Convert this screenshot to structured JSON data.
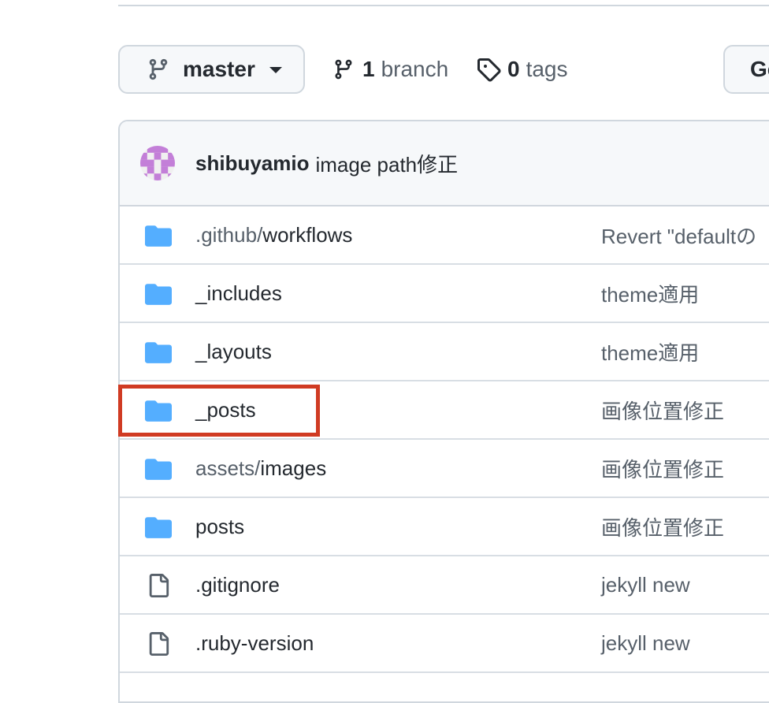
{
  "branch_selector": {
    "label": "master"
  },
  "branches": {
    "count": "1",
    "label": "branch"
  },
  "tags": {
    "count": "0",
    "label": "tags"
  },
  "goto_button": {
    "label": "Go to file"
  },
  "latest_commit": {
    "author": "shibuyamio",
    "message": "image path修正"
  },
  "files": [
    {
      "type": "dir",
      "prefix": ".github/",
      "name": "workflows",
      "commit": "Revert \"defaultの"
    },
    {
      "type": "dir",
      "prefix": "",
      "name": "_includes",
      "commit": "theme適用"
    },
    {
      "type": "dir",
      "prefix": "",
      "name": "_layouts",
      "commit": "theme適用"
    },
    {
      "type": "dir",
      "prefix": "",
      "name": "_posts",
      "commit": "画像位置修正"
    },
    {
      "type": "dir",
      "prefix": "assets/",
      "name": "images",
      "commit": "画像位置修正"
    },
    {
      "type": "dir",
      "prefix": "",
      "name": "posts",
      "commit": "画像位置修正"
    },
    {
      "type": "file",
      "prefix": "",
      "name": ".gitignore",
      "commit": "jekyll new"
    },
    {
      "type": "file",
      "prefix": "",
      "name": ".ruby-version",
      "commit": "jekyll new"
    }
  ],
  "colors": {
    "folder": "#54aeff",
    "highlight": "#d03b23",
    "avatar": "#c37fd8",
    "border": "#d0d7de"
  }
}
